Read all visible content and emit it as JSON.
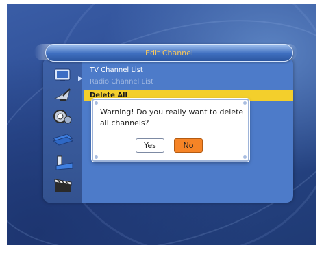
{
  "window": {
    "title": "Edit Channel"
  },
  "menu": {
    "items": [
      {
        "label": "TV Channel List"
      },
      {
        "label": "Radio Channel List"
      },
      {
        "label": "Delete All"
      }
    ],
    "side_icons": [
      "tv-icon",
      "satellite-dish-icon",
      "gear-settings-icon",
      "books-icon",
      "tools-icon",
      "clapperboard-icon"
    ]
  },
  "dialog": {
    "message": "Warning! Do you really want to delete all channels?",
    "yes_label": "Yes",
    "no_label": "No",
    "selected": "No"
  },
  "colors": {
    "title_text": "#f5c65d",
    "highlight": "#f3cf2c",
    "selected_button": "#f68426",
    "panel": "#4d7bc9"
  }
}
